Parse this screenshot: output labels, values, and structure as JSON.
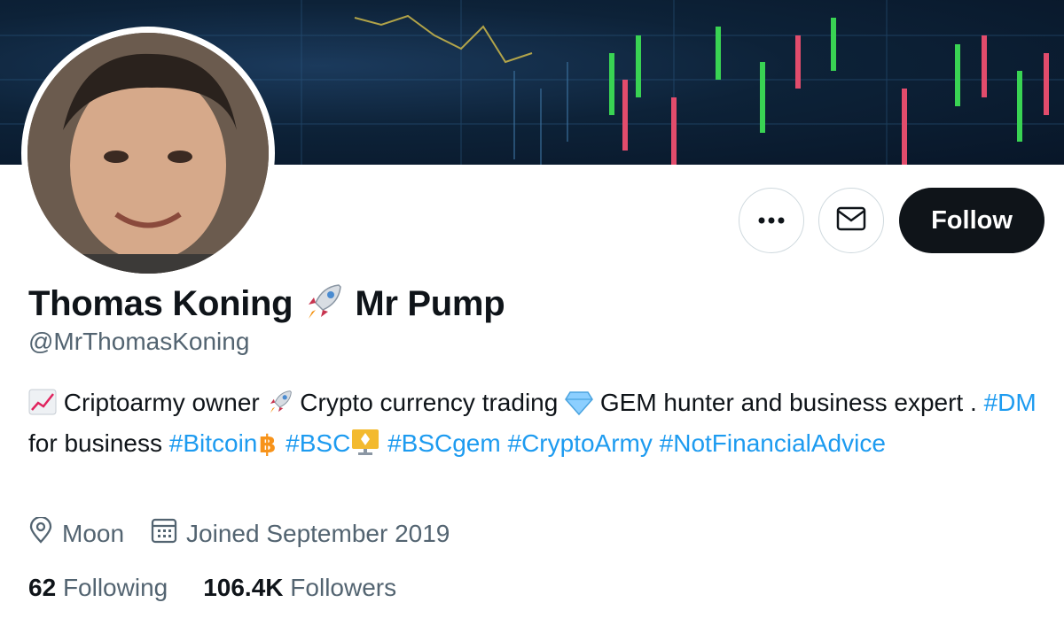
{
  "profile": {
    "display_name": "Thomas Koning",
    "display_name_suffix": "Mr Pump",
    "handle": "@MrThomasKoning",
    "follow_label": "Follow"
  },
  "bio": {
    "part1": "Criptoarmy owner",
    "part2": "Crypto currency trading",
    "part3": "GEM hunter and business expert .",
    "tag_dm": "#DM",
    "part4": "for business",
    "tag_bitcoin": "#Bitcoin",
    "tag_bsc": "#BSC",
    "tag_bscgem": "#BSCgem",
    "tag_cryptoarmy": "#CryptoArmy",
    "tag_nfa": "#NotFinancialAdvice"
  },
  "meta": {
    "location": "Moon",
    "joined": "Joined September 2019"
  },
  "stats": {
    "following_count": "62",
    "following_label": "Following",
    "followers_count": "106.4K",
    "followers_label": "Followers"
  },
  "icons": [
    "more-icon",
    "mail-icon",
    "rocket-icon",
    "chart-icon",
    "diamond-icon",
    "bitcoin-icon",
    "bsc-icon",
    "location-icon",
    "calendar-icon"
  ],
  "colors": {
    "accent": "#1d9bf0",
    "follow_bg": "#0f1419",
    "secondary_text": "#536471"
  }
}
